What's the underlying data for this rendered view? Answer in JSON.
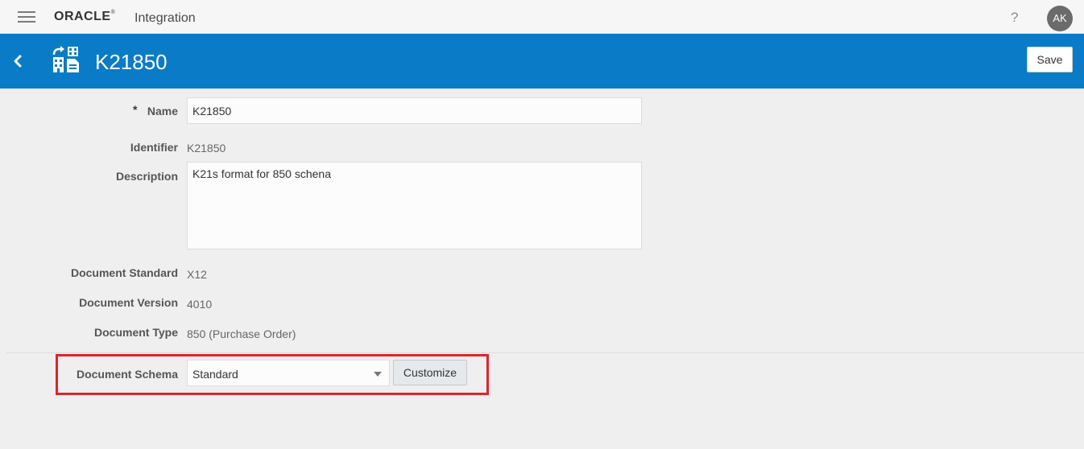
{
  "topbar": {
    "brand": "ORACLE",
    "brand_tm": "®",
    "product": "Integration",
    "help_label": "?",
    "user_initials": "AK"
  },
  "header": {
    "title": "K21850",
    "save_label": "Save",
    "background_color": "#0a7cc7"
  },
  "form": {
    "name": {
      "label": "Name",
      "required_mark": "*",
      "value": "K21850"
    },
    "identifier": {
      "label": "Identifier",
      "value": "K21850"
    },
    "description": {
      "label": "Description",
      "value": "K21s format for 850 schena"
    },
    "document_standard": {
      "label": "Document Standard",
      "value": "X12"
    },
    "document_version": {
      "label": "Document Version",
      "value": "4010"
    },
    "document_type": {
      "label": "Document Type",
      "value": "850 (Purchase Order)"
    },
    "document_schema": {
      "label": "Document Schema",
      "selected": "Standard",
      "customize_label": "Customize"
    }
  },
  "icons": {
    "menu": "hamburger-icon",
    "back": "chevron-left-icon",
    "document": "document-building-icon",
    "help": "help-icon",
    "dropdown": "caret-down-icon"
  },
  "highlight_color": "#e0232d"
}
